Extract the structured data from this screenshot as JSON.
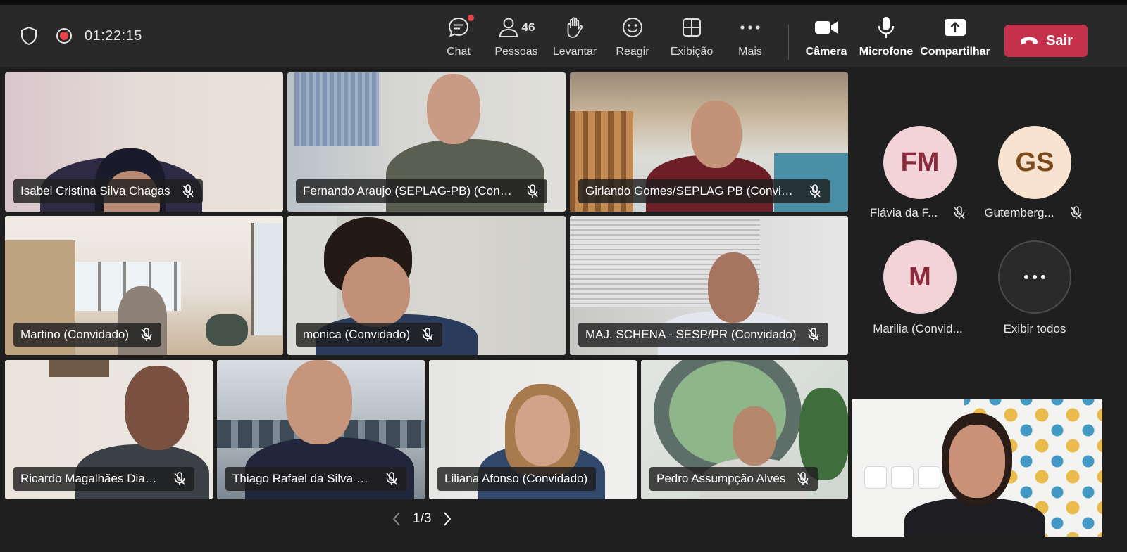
{
  "meeting": {
    "timer": "01:22:15"
  },
  "toolbar": {
    "chat": "Chat",
    "people": "Pessoas",
    "people_count": "46",
    "raise": "Levantar",
    "react": "Reagir",
    "view": "Exibição",
    "more": "Mais",
    "camera": "Câmera",
    "microphone": "Microfone",
    "share": "Compartilhar",
    "leave": "Sair"
  },
  "participants": [
    {
      "name": "Isabel Cristina Silva Chagas"
    },
    {
      "name": "Fernando Araujo (SEPLAG-PB) (Convi..."
    },
    {
      "name": "Girlando Gomes/SEPLAG PB (Convida..."
    },
    {
      "name": "Martino (Convidado)"
    },
    {
      "name": "monica (Convidado)"
    },
    {
      "name": "MAJ. SCHENA - SESP/PR (Convidado)"
    },
    {
      "name": "Ricardo Magalhães Dias ..."
    },
    {
      "name": "Thiago Rafael da Silva R..."
    },
    {
      "name": "Liliana Afonso (Convidado)"
    },
    {
      "name": "Pedro Assumpção Alves"
    }
  ],
  "side": [
    {
      "initials": "FM",
      "name": "Flávia da F...",
      "bg": "#f2d3d7",
      "fg": "#8a2b3c"
    },
    {
      "initials": "GS",
      "name": "Gutemberg...",
      "bg": "#f7e3cf",
      "fg": "#7a4a1c"
    },
    {
      "initials": "M",
      "name": "Marilia (Convid...",
      "bg": "#f2d3d7",
      "fg": "#8a2b3c"
    },
    {
      "name": "Exibir todos"
    }
  ],
  "pager": {
    "page": "1/3"
  },
  "colors": {
    "toolbar": "#292929",
    "stage": "#1f1f1f",
    "leave": "#c4314b",
    "record": "#e8434b"
  }
}
